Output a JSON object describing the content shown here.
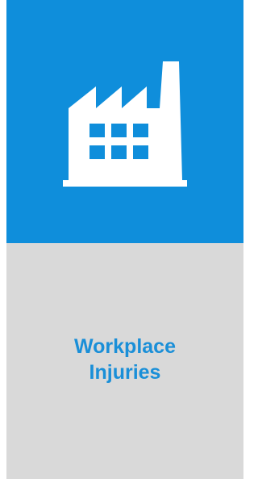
{
  "tile": {
    "label_lines": [
      "Workplace",
      "Injuries"
    ],
    "icon": "factory-icon",
    "colors": {
      "top_background": "#0f8edb",
      "bottom_background": "#d9d9d9",
      "label_text": "#1a8fd8",
      "icon": "#ffffff"
    }
  }
}
